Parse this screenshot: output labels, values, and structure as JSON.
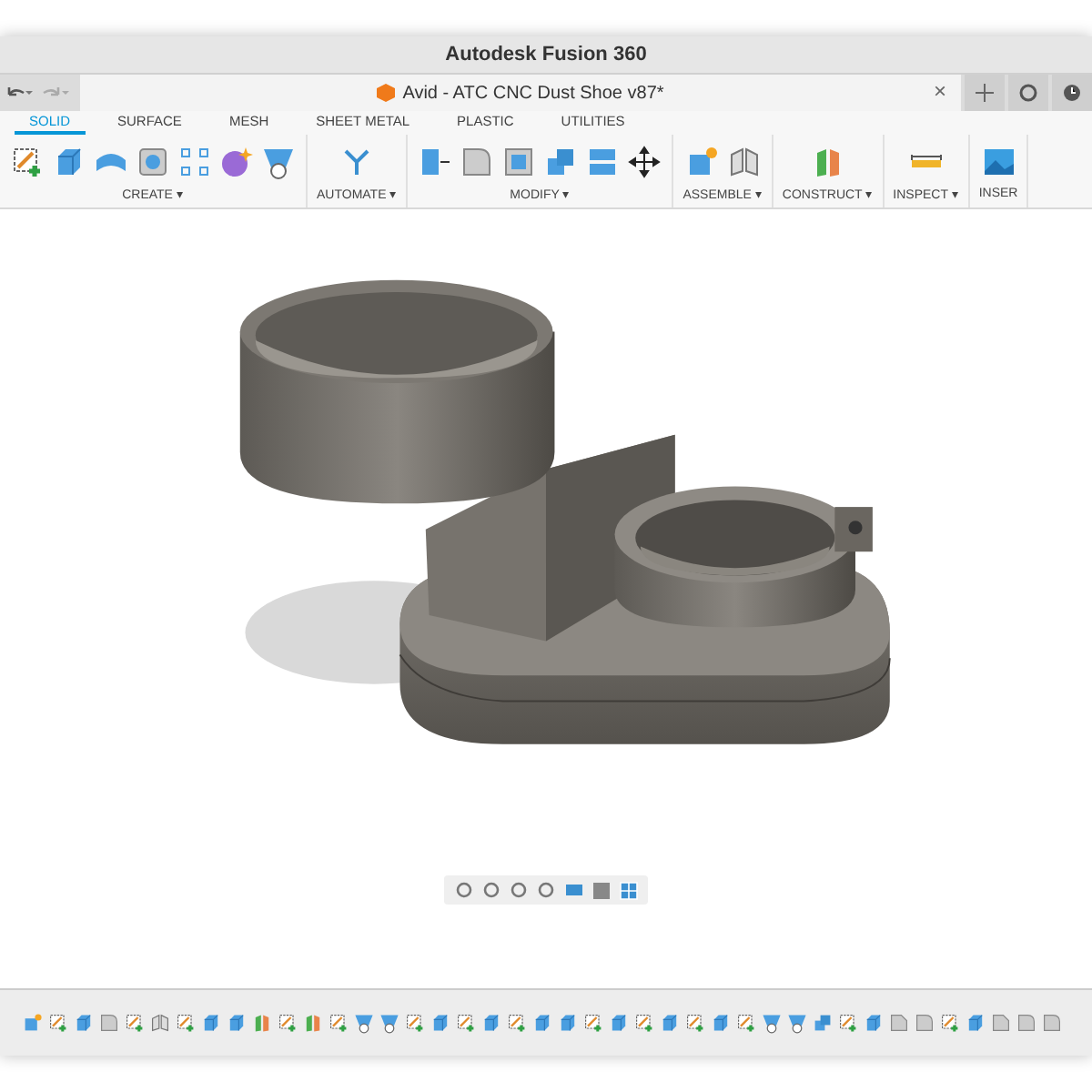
{
  "window": {
    "title": "Autodesk Fusion 360"
  },
  "document_tab": {
    "title": "Avid - ATC CNC Dust Shoe v87*",
    "close": "×"
  },
  "toolbar_tabs": [
    {
      "label": "SOLID",
      "selected": true
    },
    {
      "label": "SURFACE",
      "selected": false
    },
    {
      "label": "MESH",
      "selected": false
    },
    {
      "label": "SHEET METAL",
      "selected": false
    },
    {
      "label": "PLASTIC",
      "selected": false
    },
    {
      "label": "UTILITIES",
      "selected": false
    }
  ],
  "ribbon_groups": [
    {
      "label": "CREATE ▾",
      "tools": [
        {
          "kind": "sketch"
        },
        {
          "kind": "extrude"
        },
        {
          "kind": "revolve"
        },
        {
          "kind": "hole"
        },
        {
          "kind": "pattern"
        },
        {
          "kind": "form"
        },
        {
          "kind": "loft"
        }
      ]
    },
    {
      "label": "AUTOMATE ▾",
      "tools": [
        {
          "kind": "automate"
        }
      ]
    },
    {
      "label": "MODIFY ▾",
      "tools": [
        {
          "kind": "presspull"
        },
        {
          "kind": "fillet"
        },
        {
          "kind": "shell"
        },
        {
          "kind": "combine"
        },
        {
          "kind": "split"
        },
        {
          "kind": "move"
        }
      ]
    },
    {
      "label": "ASSEMBLE ▾",
      "tools": [
        {
          "kind": "component"
        },
        {
          "kind": "joint"
        }
      ]
    },
    {
      "label": "CONSTRUCT ▾",
      "tools": [
        {
          "kind": "plane"
        }
      ]
    },
    {
      "label": "INSPECT ▾",
      "tools": [
        {
          "kind": "measure"
        }
      ]
    },
    {
      "label": "INSER",
      "tools": [
        {
          "kind": "image"
        }
      ]
    }
  ],
  "timeline": {
    "features": [
      {
        "kind": "component"
      },
      {
        "kind": "sketch"
      },
      {
        "kind": "extrude"
      },
      {
        "kind": "fillet"
      },
      {
        "kind": "sketch"
      },
      {
        "kind": "joint"
      },
      {
        "kind": "sketch"
      },
      {
        "kind": "extrude"
      },
      {
        "kind": "extrude"
      },
      {
        "kind": "plane"
      },
      {
        "kind": "sketch"
      },
      {
        "kind": "plane"
      },
      {
        "kind": "sketch"
      },
      {
        "kind": "loft"
      },
      {
        "kind": "loft"
      },
      {
        "kind": "sketch"
      },
      {
        "kind": "extrude"
      },
      {
        "kind": "sketch"
      },
      {
        "kind": "extrude"
      },
      {
        "kind": "sketch"
      },
      {
        "kind": "extrude"
      },
      {
        "kind": "extrude"
      },
      {
        "kind": "sketch"
      },
      {
        "kind": "extrude"
      },
      {
        "kind": "sketch"
      },
      {
        "kind": "extrude"
      },
      {
        "kind": "sketch"
      },
      {
        "kind": "extrude"
      },
      {
        "kind": "sketch"
      },
      {
        "kind": "loft"
      },
      {
        "kind": "loft"
      },
      {
        "kind": "combine"
      },
      {
        "kind": "sketch"
      },
      {
        "kind": "extrude"
      },
      {
        "kind": "chamfer"
      },
      {
        "kind": "fillet"
      },
      {
        "kind": "sketch"
      },
      {
        "kind": "extrude"
      },
      {
        "kind": "chamfer"
      },
      {
        "kind": "fillet"
      },
      {
        "kind": "fillet"
      }
    ]
  }
}
